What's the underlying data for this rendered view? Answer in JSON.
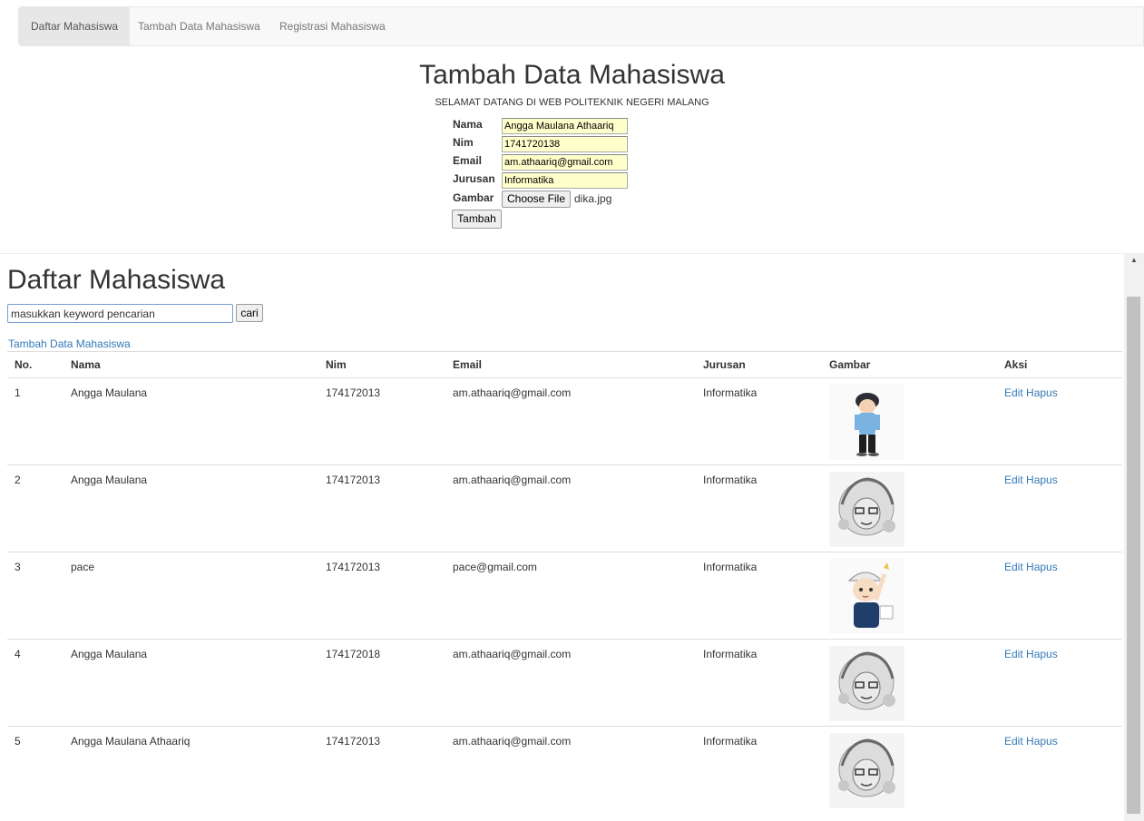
{
  "nav": {
    "tabs": [
      "Daftar Mahasiswa",
      "Tambah Data Mahasiswa",
      "Registrasi Mahasiswa"
    ],
    "active": "Daftar Mahasiswa"
  },
  "form": {
    "title": "Tambah Data Mahasiswa",
    "subtitle": "SELAMAT DATANG DI WEB POLITEKNIK NEGERI MALANG",
    "labels": {
      "nama": "Nama",
      "nim": "Nim",
      "email": "Email",
      "jurusan": "Jurusan",
      "gambar": "Gambar"
    },
    "values": {
      "nama": "Angga Maulana Athaariq",
      "nim": "1741720138",
      "email": "am.athaariq@gmail.com",
      "jurusan": "Informatika"
    },
    "choose_file_label": "Choose File",
    "file_name": "dika.jpg",
    "submit_label": "Tambah"
  },
  "list": {
    "title": "Daftar Mahasiswa",
    "search_placeholder": "masukkan keyword pencarian",
    "search_button": "cari",
    "add_link": "Tambah Data Mahasiswa",
    "columns": [
      "No.",
      "Nama",
      "Nim",
      "Email",
      "Jurusan",
      "Gambar",
      "Aksi"
    ],
    "rows": [
      {
        "no": "1",
        "nama": "Angga Maulana",
        "nim": "174172013",
        "email": "am.athaariq@gmail.com",
        "jurusan": "Informatika",
        "image": "cartoon-boy-icon",
        "edit": "Edit",
        "hapus": "Hapus"
      },
      {
        "no": "2",
        "nama": "Angga Maulana",
        "nim": "174172013",
        "email": "am.athaariq@gmail.com",
        "jurusan": "Informatika",
        "image": "sketch-portrait-icon",
        "edit": "Edit",
        "hapus": "Hapus"
      },
      {
        "no": "3",
        "nama": "pace",
        "nim": "174172013",
        "email": "pace@gmail.com",
        "jurusan": "Informatika",
        "image": "cartoon-kid-icon",
        "edit": "Edit",
        "hapus": "Hapus"
      },
      {
        "no": "4",
        "nama": "Angga Maulana",
        "nim": "174172018",
        "email": "am.athaariq@gmail.com",
        "jurusan": "Informatika",
        "image": "sketch-portrait-icon",
        "edit": "Edit",
        "hapus": "Hapus"
      },
      {
        "no": "5",
        "nama": "Angga Maulana Athaariq",
        "nim": "174172013",
        "email": "am.athaariq@gmail.com",
        "jurusan": "Informatika",
        "image": "sketch-portrait-icon",
        "edit": "Edit",
        "hapus": "Hapus"
      }
    ]
  },
  "colors": {
    "link": "#337ab7",
    "input_fill": "#ffffcc",
    "navbar_bg": "#f8f8f8",
    "active_tab_bg": "#e7e7e7"
  }
}
